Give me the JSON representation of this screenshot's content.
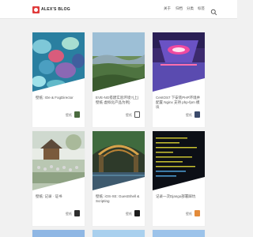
{
  "header": {
    "brand": "ALEX'S BLOG",
    "nav": [
      "关于",
      "归档",
      "分类",
      "标签"
    ]
  },
  "posts": [
    {
      "title": "壁纸: IOe & FogDirector",
      "category": "壁纸"
    },
    {
      "title": "EVE-NG搭建实验环境?(上)壁纸·虚拟化产品为例)",
      "category": "壁纸"
    },
    {
      "title": "CentOS7 下安装PHP环境并配置 Nginx 支持 php-fpm 模块",
      "category": "壁纸"
    },
    {
      "title": "壁纸: 记录 · 证书",
      "category": "壁纸"
    },
    {
      "title": "壁纸: iOS-XE: GuestShell & Scripting",
      "category": "壁纸"
    },
    {
      "title": "记录一次Django部署踩坑",
      "category": "壁纸"
    }
  ],
  "colors": {
    "accent": "#e03b3b",
    "background": "#f1f1f1",
    "card": "#ffffff"
  }
}
